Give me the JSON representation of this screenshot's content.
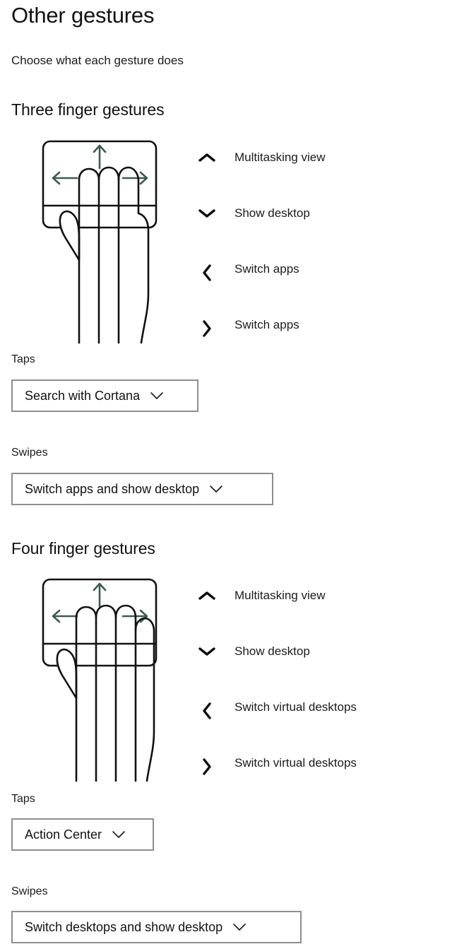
{
  "page": {
    "title": "Other gestures",
    "subtitle": "Choose what each gesture does"
  },
  "colors": {
    "text": "#1b1b1b",
    "heading": "#111111",
    "arrow_green": "#3d5a52",
    "outline": "#111111",
    "dropdown_border": "#8e8e8e",
    "background": "#ffffff"
  },
  "sections": [
    {
      "title": "Three finger gestures",
      "illustration": {
        "name": "three-finger-touchpad-illustration",
        "fingers": 3,
        "arrows": [
          "up",
          "left",
          "right"
        ]
      },
      "gestures": [
        {
          "icon": "chevron-up-icon",
          "direction": "up",
          "label": "Multitasking view"
        },
        {
          "icon": "chevron-down-icon",
          "direction": "down",
          "label": "Show desktop"
        },
        {
          "icon": "chevron-left-icon",
          "direction": "left",
          "label": "Switch apps"
        },
        {
          "icon": "chevron-right-icon",
          "direction": "right",
          "label": "Switch apps"
        }
      ],
      "taps": {
        "label": "Taps",
        "value": "Search with Cortana",
        "chevron": "chevron-down-icon"
      },
      "swipes": {
        "label": "Swipes",
        "value": "Switch apps and show desktop",
        "chevron": "chevron-down-icon"
      }
    },
    {
      "title": "Four finger gestures",
      "illustration": {
        "name": "four-finger-touchpad-illustration",
        "fingers": 4,
        "arrows": [
          "up",
          "left",
          "right"
        ]
      },
      "gestures": [
        {
          "icon": "chevron-up-icon",
          "direction": "up",
          "label": "Multitasking view"
        },
        {
          "icon": "chevron-down-icon",
          "direction": "down",
          "label": "Show desktop"
        },
        {
          "icon": "chevron-left-icon",
          "direction": "left",
          "label": "Switch virtual desktops"
        },
        {
          "icon": "chevron-right-icon",
          "direction": "right",
          "label": "Switch virtual desktops"
        }
      ],
      "taps": {
        "label": "Taps",
        "value": "Action Center",
        "chevron": "chevron-down-icon"
      },
      "swipes": {
        "label": "Swipes",
        "value": "Switch desktops and show desktop",
        "chevron": "chevron-down-icon"
      }
    }
  ]
}
